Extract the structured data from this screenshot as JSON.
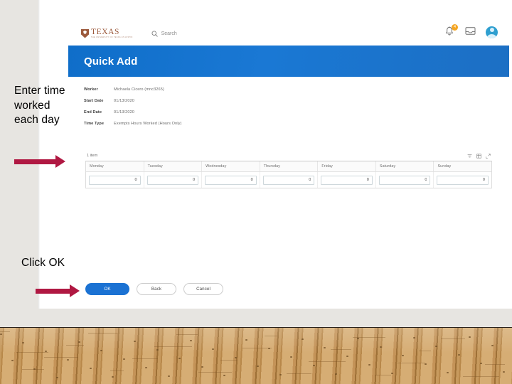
{
  "slide": {
    "annotations": [
      {
        "id": "enter-time",
        "text": "Enter time worked each day",
        "arrow_color": "#b01842"
      },
      {
        "id": "click-ok",
        "text": "Click OK",
        "arrow_color": "#b01842"
      }
    ]
  },
  "app": {
    "brand": {
      "wordmark": "TEXAS",
      "subtext": "THE UNIVERSITY OF TEXAS AT AUSTIN",
      "color": "#9c5a3c"
    },
    "search": {
      "placeholder": "Search",
      "icon": "search-icon"
    },
    "nav_icons": [
      {
        "name": "notifications-bell-icon",
        "badge": "4"
      },
      {
        "name": "inbox-tray-icon"
      },
      {
        "name": "profile-avatar"
      }
    ]
  },
  "banner": {
    "title": "Quick Add",
    "color": "#1a78d4"
  },
  "form": {
    "fields": [
      {
        "label": "Worker",
        "value": "Michaela Cicero (mnc3265)"
      },
      {
        "label": "Start Date",
        "value": "01/13/2020"
      },
      {
        "label": "End Date",
        "value": "01/13/2020"
      },
      {
        "label": "Time Type",
        "value": "Exempts Hours Worked (Hours Only)"
      }
    ]
  },
  "grid": {
    "item_count": "1 item",
    "toolbar_icons": [
      {
        "name": "filter-icon"
      },
      {
        "name": "grid-view-icon"
      },
      {
        "name": "expand-icon"
      }
    ],
    "columns": [
      "Monday",
      "Tuesday",
      "Wednesday",
      "Thursday",
      "Friday",
      "Saturday",
      "Sunday"
    ],
    "rows": [
      {
        "values": [
          "0",
          "0",
          "0",
          "0",
          "0",
          "0",
          "0"
        ]
      }
    ]
  },
  "buttons": {
    "ok": "OK",
    "back": "Back",
    "cancel": "Cancel",
    "ok_color": "#1b72d3"
  }
}
